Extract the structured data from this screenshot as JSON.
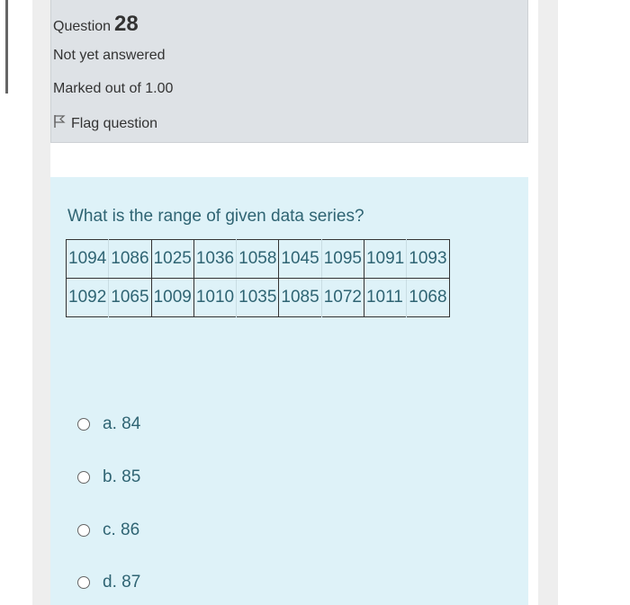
{
  "info": {
    "question_label": "Question",
    "question_number": "28",
    "state": "Not yet answered",
    "grade": "Marked out of 1.00",
    "flag_label": "Flag question"
  },
  "question": {
    "text": "What is the range of given data series?",
    "rows": [
      [
        "1094",
        "1086",
        "1025",
        "1036",
        "1058",
        "1045",
        "1095",
        "1091",
        "1093"
      ],
      [
        "1092",
        "1065",
        "1009",
        "1010",
        "1035",
        "1085",
        "1072",
        "1011",
        "1068"
      ]
    ]
  },
  "answers": [
    {
      "label": "a. 84"
    },
    {
      "label": "b. 85"
    },
    {
      "label": "c. 86"
    },
    {
      "label": "d. 87"
    }
  ],
  "icons": {
    "flag": "flag-icon",
    "radio": "radio-button"
  },
  "colors": {
    "info_bg": "#dee2e6",
    "content_bg": "#def2f8",
    "content_text": "#2f6473",
    "info_text": "#333333"
  }
}
